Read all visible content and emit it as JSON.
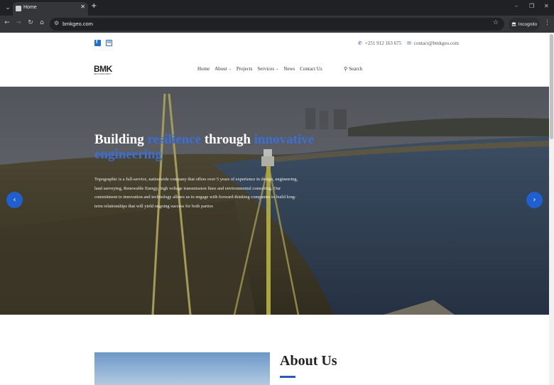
{
  "browser": {
    "tab_title": "Home",
    "url": "bmkgeo.com",
    "incognito_label": "Incognito",
    "icons": {
      "tab_close": "✕",
      "new_tab": "+",
      "back": "←",
      "forward": "→",
      "reload": "↻",
      "home": "⌂",
      "star": "☆",
      "minimize": "–",
      "restore": "❐",
      "close": "✕",
      "menu": "⋮",
      "tab_menu": "⌄",
      "site_info": "⚙"
    }
  },
  "topbar": {
    "phone": "+251 912 163 675",
    "email": "contact@bmkgeo.com",
    "phone_icon": "✆",
    "email_icon": "✉"
  },
  "nav": {
    "logo_text": "BMK",
    "logo_sub": "GEO CONSULTANCY",
    "items": [
      {
        "label": "Home"
      },
      {
        "label": "About",
        "dropdown": true
      },
      {
        "label": "Projects"
      },
      {
        "label": "Services",
        "dropdown": true
      },
      {
        "label": "News"
      },
      {
        "label": "Contact Us"
      }
    ],
    "caret": "⌄",
    "search_label": "Search",
    "search_icon": "⚲"
  },
  "hero": {
    "title_parts": [
      "Building ",
      "resilience",
      " through ",
      "innovative engineering"
    ],
    "text": "Topographic is a full-service, nationwide company that offers over 5 years of experience in design, engineering, land surveying, Renewable Energy, high voltage transmission lines and environmental consulting. Our commitment to innovation and technology allows us to engage with forward-thinking companies to build long-term relationships that will yield ongoing success for both parties",
    "prev_icon": "‹",
    "next_icon": "›"
  },
  "about": {
    "title": "About Us"
  },
  "colors": {
    "accent": "#2a5db0",
    "hero_highlight": "#3b6fd4",
    "chrome_dark": "#202124"
  }
}
